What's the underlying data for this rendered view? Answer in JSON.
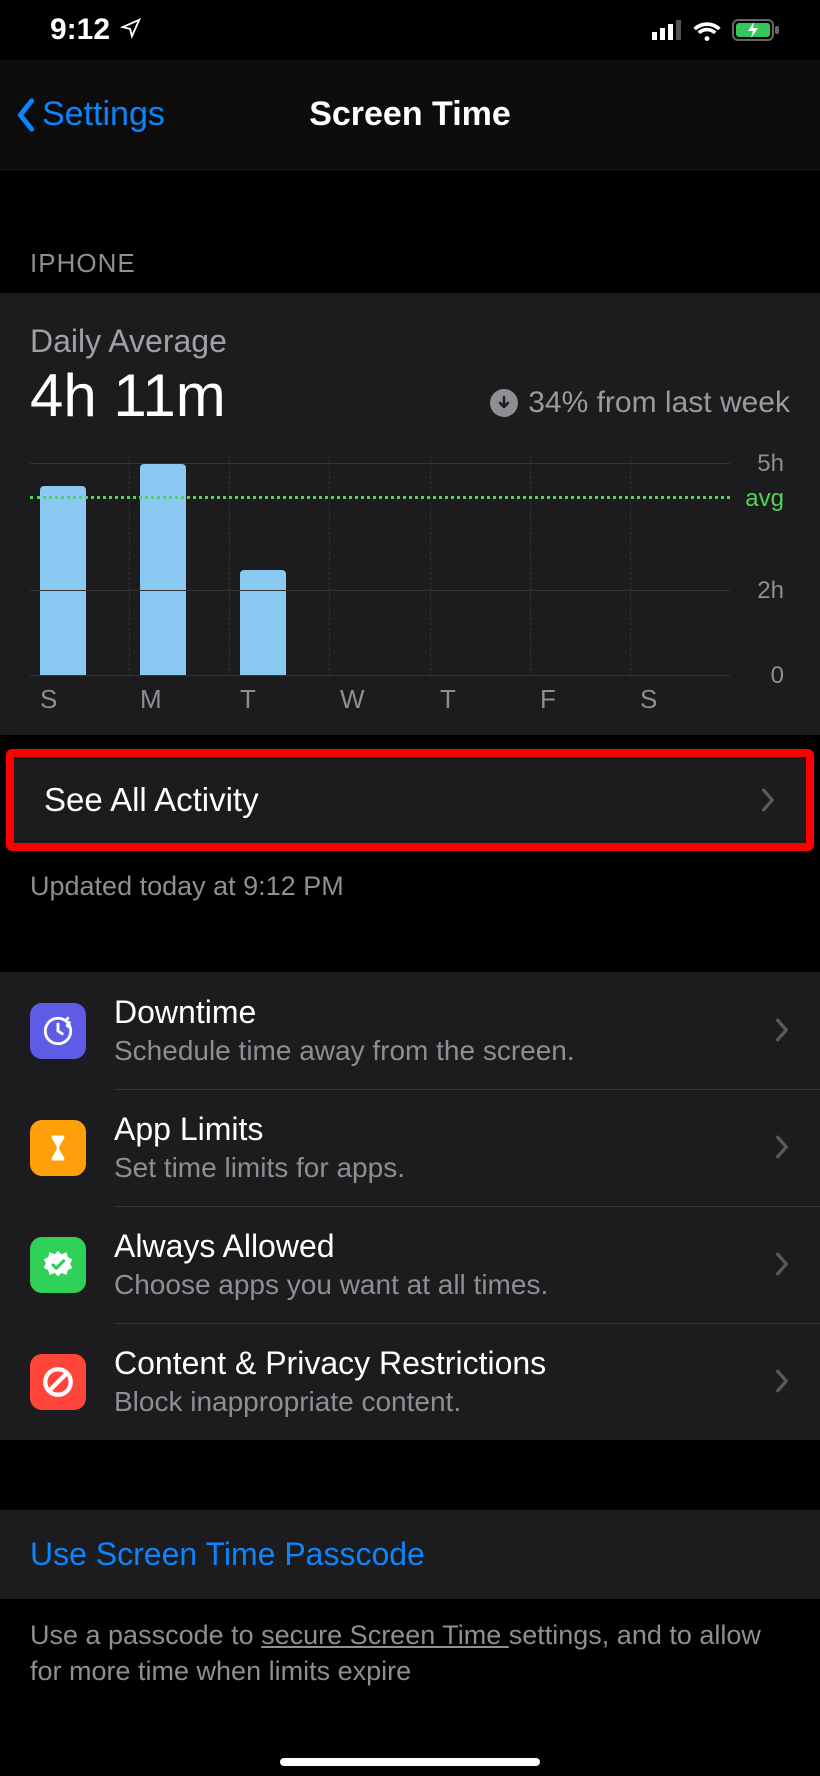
{
  "status": {
    "time": "9:12"
  },
  "nav": {
    "back": "Settings",
    "title": "Screen Time"
  },
  "section_label": "IPHONE",
  "summary": {
    "label": "Daily Average",
    "value": "4h 11m",
    "diff": "34% from last week"
  },
  "chart_data": {
    "type": "bar",
    "categories": [
      "S",
      "M",
      "T",
      "W",
      "T",
      "F",
      "S"
    ],
    "values": [
      4.5,
      5.0,
      2.5,
      0,
      0,
      0,
      0
    ],
    "avg": 4.18,
    "avg_label": "avg",
    "ylabels": [
      {
        "v": 5,
        "t": "5h"
      },
      {
        "v": 2,
        "t": "2h"
      },
      {
        "v": 0,
        "t": "0"
      }
    ],
    "ylim": [
      0,
      5.2
    ],
    "title": "",
    "xlabel": "",
    "ylabel": ""
  },
  "see_all": "See All Activity",
  "updated": "Updated today at 9:12 PM",
  "options": [
    {
      "name": "downtime",
      "title": "Downtime",
      "sub": "Schedule time away from the screen.",
      "color": "#5e5ce6"
    },
    {
      "name": "app-limits",
      "title": "App Limits",
      "sub": "Set time limits for apps.",
      "color": "#ff9f0a"
    },
    {
      "name": "always-allowed",
      "title": "Always Allowed",
      "sub": "Choose apps you want at all times.",
      "color": "#30d158"
    },
    {
      "name": "content-privacy",
      "title": "Content & Privacy Restrictions",
      "sub": "Block inappropriate content.",
      "color": "#ff453a"
    }
  ],
  "passcode": {
    "label": "Use Screen Time Passcode",
    "desc_pre": "Use a passcode to ",
    "desc_u": "secure Screen Time ",
    "desc_post": "settings, and to allow for more time when limits expire"
  }
}
